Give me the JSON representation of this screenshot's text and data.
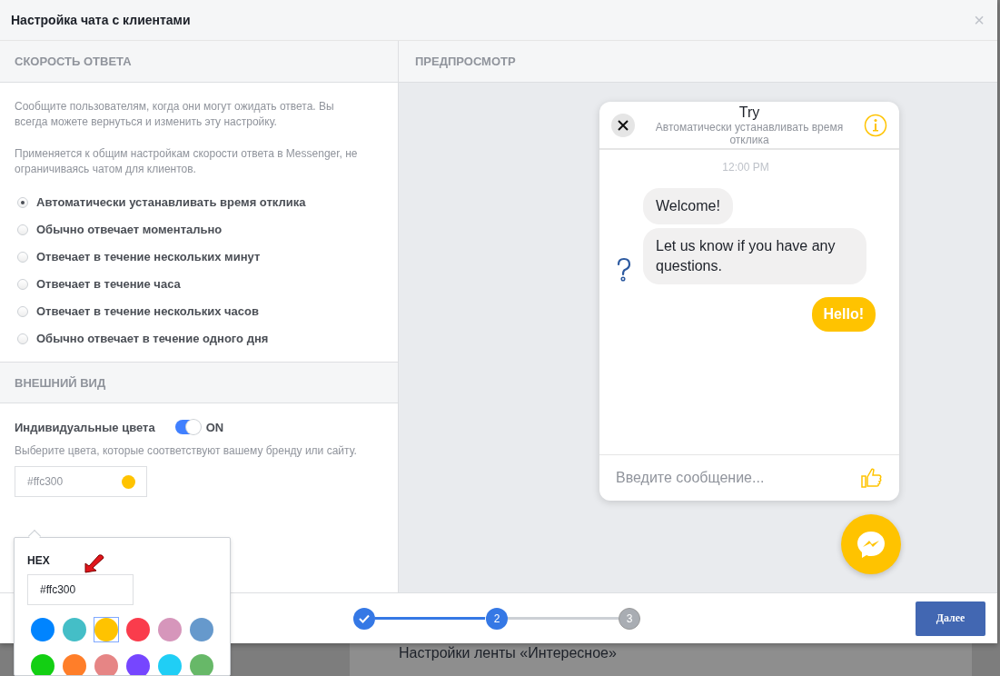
{
  "dialog": {
    "title": "Настройка чата с клиентами",
    "close": "×"
  },
  "response_speed": {
    "heading": "СКОРОСТЬ ОТВЕТА",
    "paragraphs": [
      "Сообщите пользователям, когда они могут ожидать ответа. Вы всегда можете вернуться и изменить эту настройку.",
      "Применяется к общим настройкам скорости ответа в Messenger, не ограничиваясь чатом для клиентов."
    ],
    "options": [
      {
        "label": "Автоматически устанавливать время отклика",
        "selected": true
      },
      {
        "label": "Обычно отвечает моментально",
        "selected": false
      },
      {
        "label": "Отвечает в течение нескольких минут",
        "selected": false
      },
      {
        "label": "Отвечает в течение часа",
        "selected": false
      },
      {
        "label": "Отвечает в течение нескольких часов",
        "selected": false
      },
      {
        "label": "Обычно отвечает в течение одного дня",
        "selected": false
      }
    ]
  },
  "appearance": {
    "heading": "ВНЕШНИЙ ВИД",
    "custom_colors": {
      "label": "Индивидуальные цвета",
      "on": true,
      "state_text": "ON"
    },
    "hint": "Выберите цвета, которые соответствуют вашему бренду или сайту.",
    "color_field": {
      "value": "#ffc300",
      "color": "#ffc300"
    },
    "picker": {
      "label": "HEX",
      "value": "#ffc300",
      "swatches": [
        {
          "color": "#0084ff",
          "selected": false
        },
        {
          "color": "#44bec7",
          "selected": false
        },
        {
          "color": "#ffc300",
          "selected": true
        },
        {
          "color": "#fa3c4c",
          "selected": false
        },
        {
          "color": "#d696bb",
          "selected": false
        },
        {
          "color": "#6699cc",
          "selected": false
        },
        {
          "color": "#13cf13",
          "selected": false
        },
        {
          "color": "#ff7e29",
          "selected": false
        },
        {
          "color": "#e68585",
          "selected": false
        },
        {
          "color": "#7646ff",
          "selected": false
        },
        {
          "color": "#20cef5",
          "selected": false
        },
        {
          "color": "#67b868",
          "selected": false
        }
      ]
    }
  },
  "preview": {
    "heading": "ПРЕДПРОСМОТР",
    "chat": {
      "name": "Try",
      "subtitle": "Автоматически устанавливать время отклика",
      "time": "12:00 PM",
      "messages": [
        {
          "text": "Welcome!",
          "outgoing": false
        },
        {
          "text": "Let us know if you have any questions.",
          "outgoing": false
        },
        {
          "text": "Hello!",
          "outgoing": true
        }
      ],
      "composer_placeholder": "Введите сообщение..."
    }
  },
  "stepper": {
    "steps": [
      {
        "done": true,
        "current": false
      },
      {
        "label": "2",
        "done": false,
        "current": true
      },
      {
        "label": "3",
        "done": false,
        "current": false
      }
    ]
  },
  "next_button": "Далее",
  "background_text": "Настройки ленты «Интересное»"
}
